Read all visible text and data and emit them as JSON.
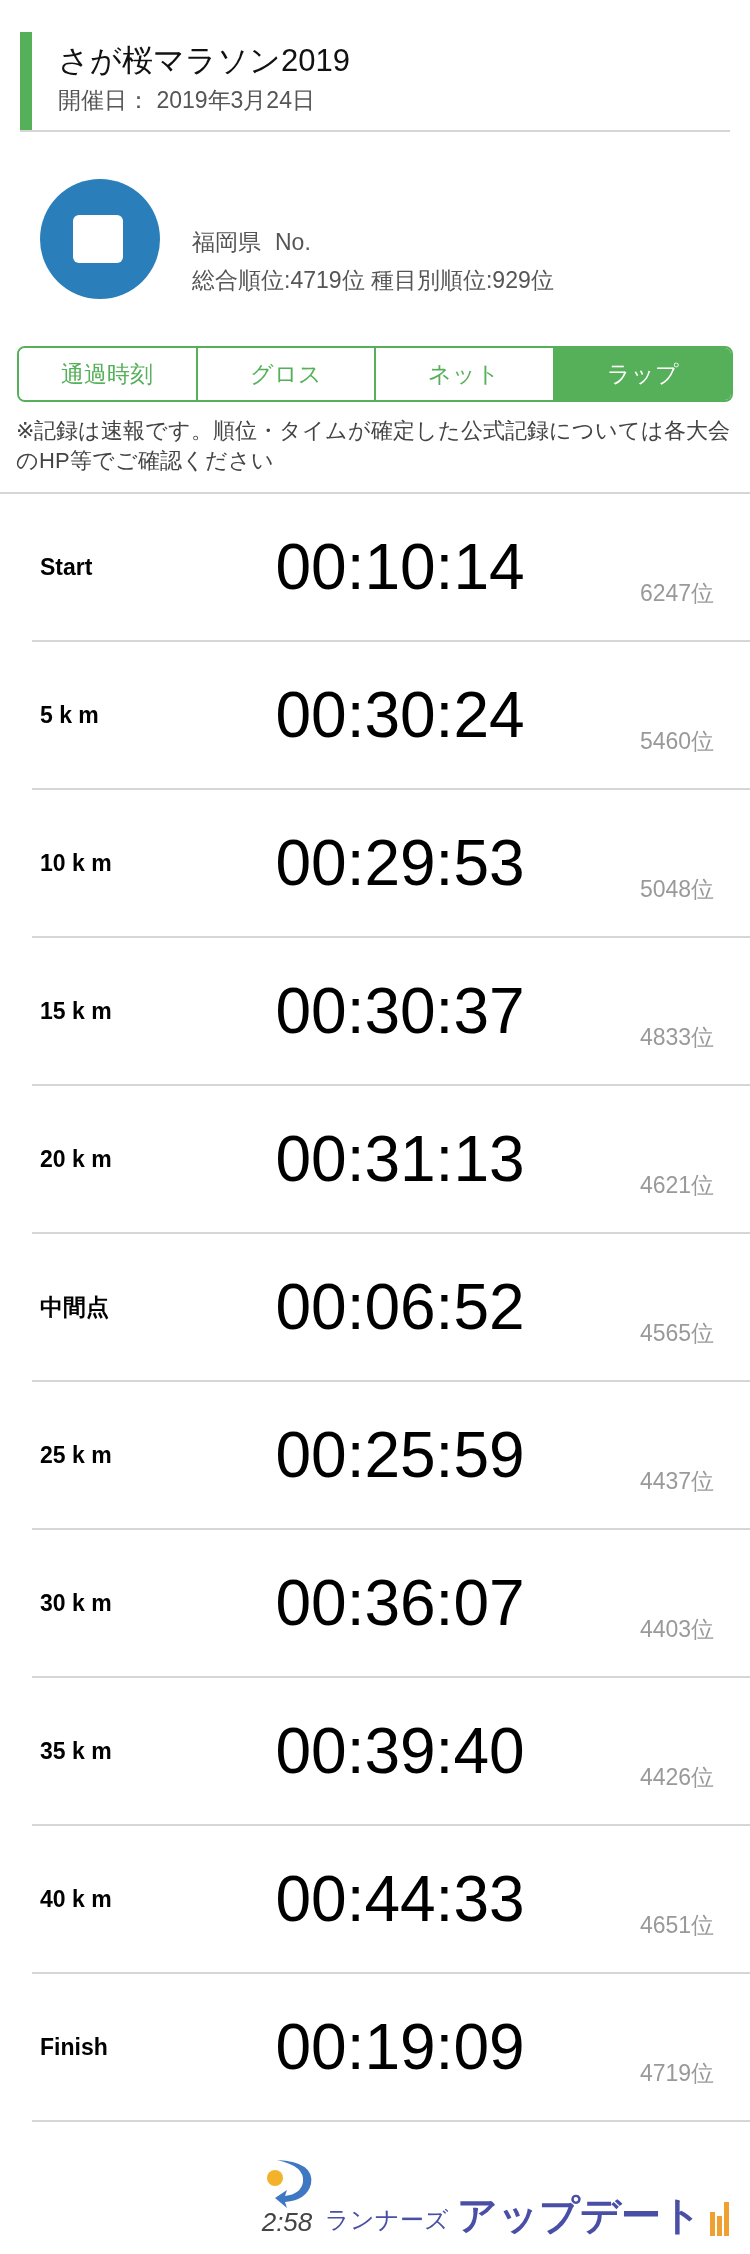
{
  "header": {
    "title": "さが桜マラソン2019",
    "date": "開催日： 2019年3月24日"
  },
  "runner": {
    "prefecture": "福岡県",
    "number": "No.",
    "ranks": "総合順位:4719位 種目別順位:929位"
  },
  "tabs": [
    {
      "label": "通過時刻",
      "selected": false
    },
    {
      "label": "グロス",
      "selected": false
    },
    {
      "label": "ネット",
      "selected": false
    },
    {
      "label": "ラップ",
      "selected": true
    }
  ],
  "notice": "※記録は速報です。順位・タイムが確定した公式記録については各大会のHP等でご確認ください",
  "splits": [
    {
      "label": "Start",
      "time": "00:10:14",
      "rank": "6247位"
    },
    {
      "label": "5 k m",
      "time": "00:30:24",
      "rank": "5460位"
    },
    {
      "label": "10 k m",
      "time": "00:29:53",
      "rank": "5048位"
    },
    {
      "label": "15 k m",
      "time": "00:30:37",
      "rank": "4833位"
    },
    {
      "label": "20 k m",
      "time": "00:31:13",
      "rank": "4621位"
    },
    {
      "label": "中間点",
      "time": "00:06:52",
      "rank": "4565位"
    },
    {
      "label": "25 k m",
      "time": "00:25:59",
      "rank": "4437位"
    },
    {
      "label": "30 k m",
      "time": "00:36:07",
      "rank": "4403位"
    },
    {
      "label": "35 k m",
      "time": "00:39:40",
      "rank": "4426位"
    },
    {
      "label": "40 k m",
      "time": "00:44:33",
      "rank": "4651位"
    },
    {
      "label": "Finish",
      "time": "00:19:09",
      "rank": "4719位"
    }
  ],
  "footer": {
    "logo": {
      "clock": "2:58",
      "tagline": "ランナーズ",
      "name": "アップデート"
    }
  }
}
